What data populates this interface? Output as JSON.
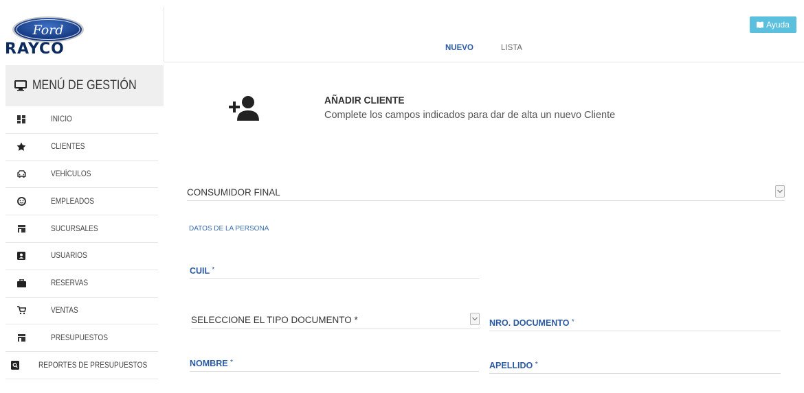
{
  "brand": {
    "logo_text": "Ford",
    "name": "RAYCO"
  },
  "topbar": {
    "tabs": [
      {
        "label": "NUEVO",
        "active": true
      },
      {
        "label": "LISTA",
        "active": false
      }
    ],
    "help_label": "Ayuda"
  },
  "sidebar": {
    "header": "MENÚ DE GESTIÓN",
    "items": [
      {
        "label": "INICIO",
        "icon": "dashboard-icon"
      },
      {
        "label": "CLIENTES",
        "icon": "star-icon"
      },
      {
        "label": "VEHÍCULOS",
        "icon": "car-icon"
      },
      {
        "label": "EMPLEADOS",
        "icon": "smiley-icon"
      },
      {
        "label": "SUCURSALES",
        "icon": "store-icon"
      },
      {
        "label": "USUARIOS",
        "icon": "id-card-icon"
      },
      {
        "label": "RESERVAS",
        "icon": "briefcase-icon"
      },
      {
        "label": "VENTAS",
        "icon": "cart-icon"
      },
      {
        "label": "PRESUPUESTOS",
        "icon": "store-icon"
      },
      {
        "label": "REPORTES DE PRESUPUESTOS",
        "icon": "search-report-icon"
      }
    ]
  },
  "form": {
    "title": "AÑADIR CLIENTE",
    "subtitle": "Complete los campos indicados para dar de alta un nuevo Cliente",
    "client_type_selected": "CONSUMIDOR FINAL",
    "section_label": "DATOS DE LA PERSONA",
    "cuil_label": "CUIL",
    "doc_type_placeholder": "SELECCIONE EL TIPO DOCUMENTO *",
    "doc_number_label": "NRO. DOCUMENTO",
    "name_label": "NOMBRE",
    "lastname_label": "APELLIDO",
    "required_mark": "*"
  },
  "colors": {
    "accent": "#2a5aa5",
    "help_button": "#5bc0de",
    "brand_navy": "#0b2a5e"
  }
}
